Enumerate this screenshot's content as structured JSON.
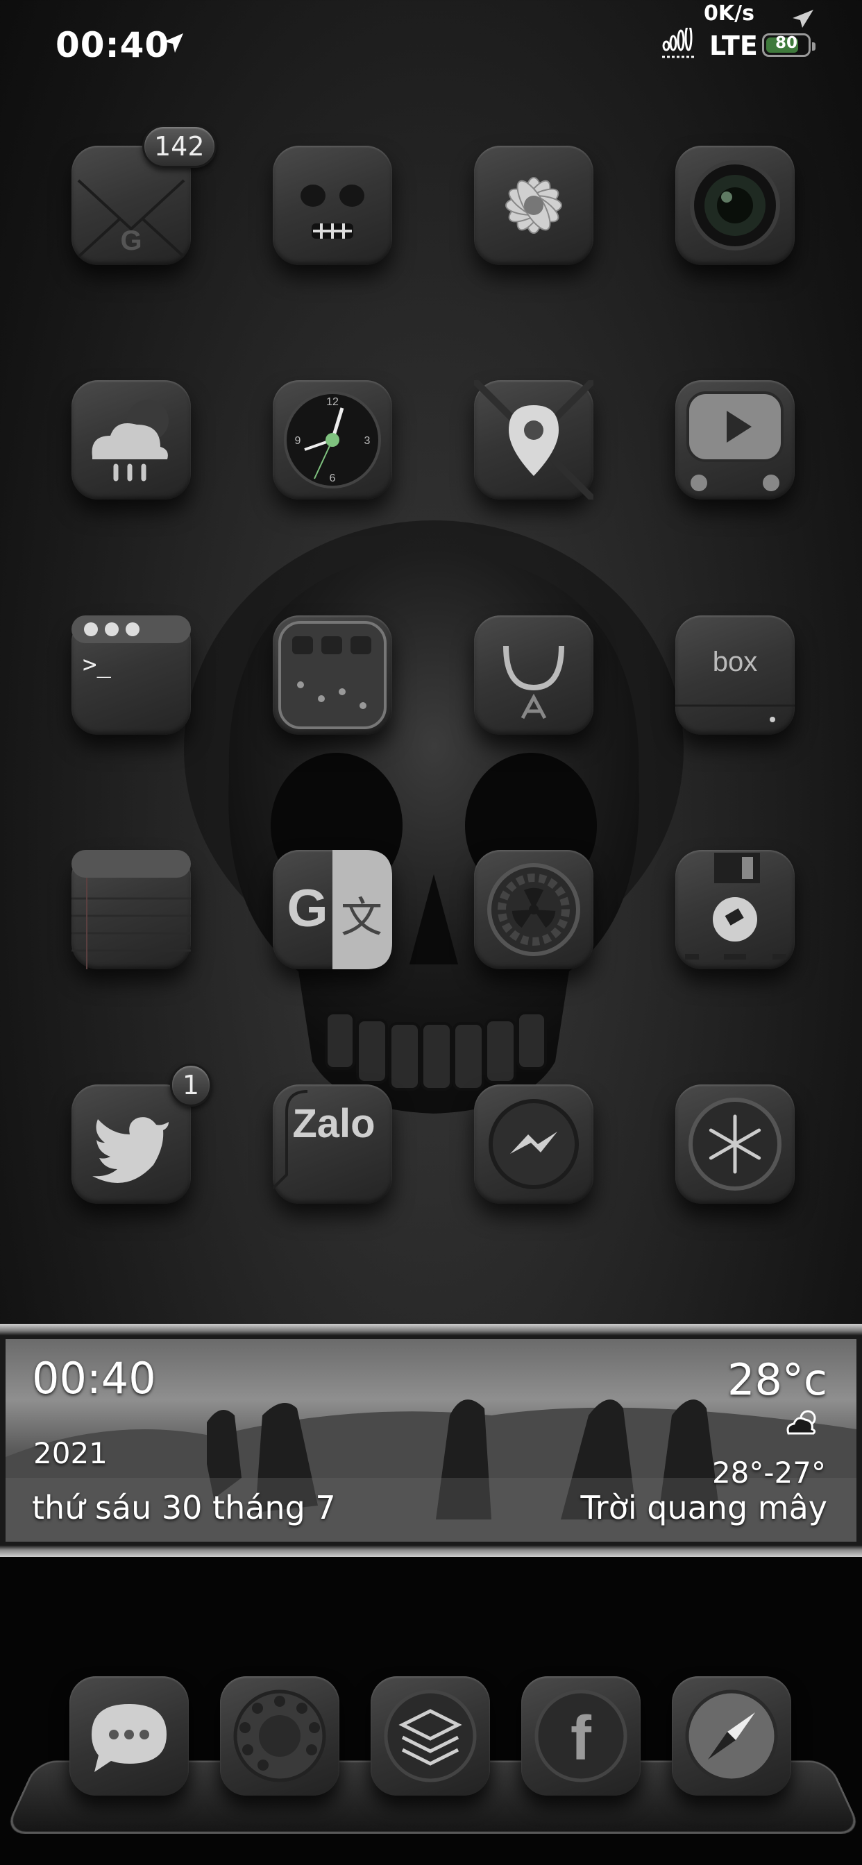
{
  "status_bar": {
    "time": "00:40",
    "net_speed": "0K/s",
    "network_type": "LTE",
    "battery_level": "80",
    "battery_fraction": 0.8
  },
  "apps": [
    {
      "name": "gmail-app",
      "icon": "envelope-g-icon",
      "badge": "142"
    },
    {
      "name": "face-app",
      "icon": "grimace-face-icon"
    },
    {
      "name": "photos-app",
      "icon": "flower-icon"
    },
    {
      "name": "camera-app",
      "icon": "camera-lens-icon"
    },
    {
      "name": "weather-app",
      "icon": "rain-cloud-icon"
    },
    {
      "name": "clock-app",
      "icon": "clock-icon"
    },
    {
      "name": "maps-app",
      "icon": "map-pin-icon"
    },
    {
      "name": "youtube-app",
      "icon": "tv-play-icon"
    },
    {
      "name": "terminal-app",
      "icon": "terminal-icon"
    },
    {
      "name": "utility-app",
      "icon": "device-icon"
    },
    {
      "name": "app-store-app",
      "icon": "shopping-bag-icon"
    },
    {
      "name": "box-app",
      "icon": "box-icon"
    },
    {
      "name": "notes-app",
      "icon": "notepad-icon"
    },
    {
      "name": "translate-app",
      "icon": "translate-icon"
    },
    {
      "name": "settings-app",
      "icon": "radiation-gear-icon"
    },
    {
      "name": "files-app",
      "icon": "floppy-disk-icon"
    },
    {
      "name": "twitter-app",
      "icon": "bird-icon",
      "badge": "1"
    },
    {
      "name": "zalo-app",
      "icon": "zalo-icon",
      "label": "Zalo"
    },
    {
      "name": "messenger-app",
      "icon": "messenger-bolt-icon"
    },
    {
      "name": "snowflake-app",
      "icon": "snowflake-icon"
    }
  ],
  "widget": {
    "time": "00:40",
    "year": "2021",
    "date": "thứ sáu 30 tháng 7",
    "temperature": "28°c",
    "range": "28°-27°",
    "condition": "Trời quang mây",
    "weather_icon": "partly-cloudy-icon"
  },
  "dock": [
    {
      "name": "messages-app",
      "icon": "chat-bubble-icon"
    },
    {
      "name": "phone-app",
      "icon": "rotary-dial-icon"
    },
    {
      "name": "stack-app",
      "icon": "layers-icon"
    },
    {
      "name": "facebook-app",
      "icon": "facebook-icon"
    },
    {
      "name": "safari-app",
      "icon": "compass-icon"
    }
  ],
  "colors": {
    "battery_fill": "#3f7a3c",
    "background": "#262626"
  }
}
